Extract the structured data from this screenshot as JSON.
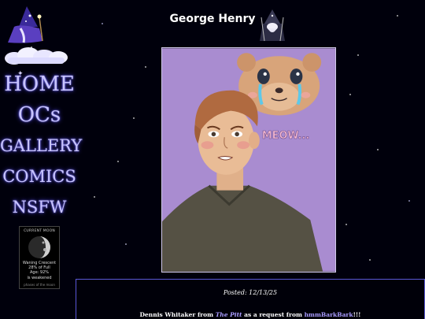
{
  "page": {
    "title": "George Henry"
  },
  "sidebar": {
    "nav": [
      {
        "label": "HOME"
      },
      {
        "label": "OCs"
      },
      {
        "label": "GALLERY"
      },
      {
        "label": "COMICS"
      },
      {
        "label": "NSFW"
      }
    ],
    "moon": {
      "title": "CURRENT MOON",
      "phase": "Waning Crescent",
      "illumination": "28% of Full",
      "age": "Age: 92%",
      "note": "is weakened",
      "footer": "phases of the moon"
    }
  },
  "artwork": {
    "speech_text": "MEOW..."
  },
  "post": {
    "posted": "Posted: 12/13/25",
    "desc_start": "Dennis Whitaker from",
    "show": "The Pitt",
    "desc_mid": "as a request from",
    "requester": "hmmBarkBark",
    "desc_end": "!!!"
  },
  "colors": {
    "background": "#00000c",
    "nav_text": "#c8c4ff",
    "link": "#a99cff",
    "post_border": "#5a58d6",
    "art_background": "#a98cd0"
  },
  "icons": [
    "wizard-icon",
    "cloud-icon",
    "sparkle-icon",
    "moon-icon",
    "wizard-mascot-icon"
  ]
}
